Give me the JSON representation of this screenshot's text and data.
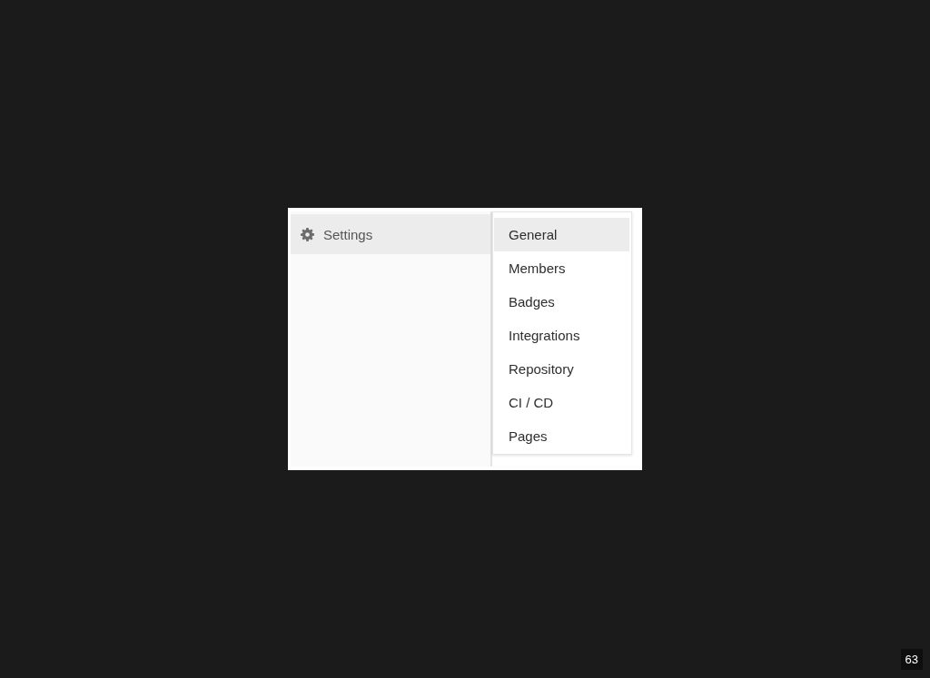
{
  "sidebar": {
    "items": [
      {
        "label": "Settings"
      }
    ]
  },
  "flyout_menu": {
    "items": [
      {
        "label": "General",
        "selected": true
      },
      {
        "label": "Members",
        "selected": false
      },
      {
        "label": "Badges",
        "selected": false
      },
      {
        "label": "Integrations",
        "selected": false
      },
      {
        "label": "Repository",
        "selected": false
      },
      {
        "label": "CI / CD",
        "selected": false
      },
      {
        "label": "Pages",
        "selected": false
      }
    ]
  },
  "slide_number": "63"
}
